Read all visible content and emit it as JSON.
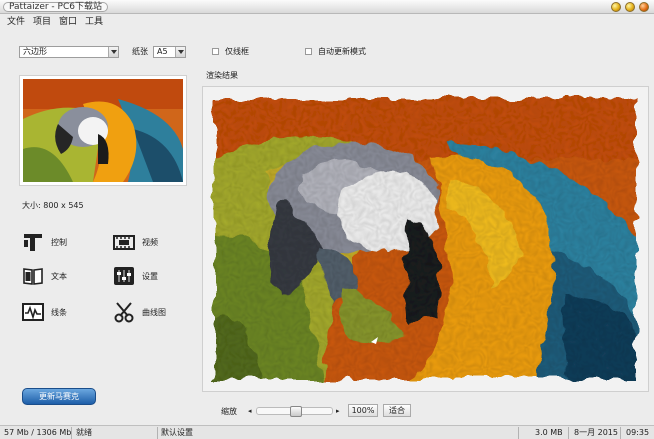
{
  "window": {
    "title": "Pattaizer - PC6下载站"
  },
  "menu": [
    "文件",
    "项目",
    "窗口",
    "工具"
  ],
  "controls": {
    "shape_select": "六边形",
    "paper_label": "纸张",
    "paper_select": "A5",
    "wireframe_label": "仅线框",
    "autoupdate_label": "自动更新模式"
  },
  "thumb": {
    "size_label": "大小: 800 x 545"
  },
  "tools": [
    {
      "label": "控制",
      "icon": "control-icon"
    },
    {
      "label": "视频",
      "icon": "film-icon"
    },
    {
      "label": "文本",
      "icon": "book-icon"
    },
    {
      "label": "设置",
      "icon": "sliders-icon"
    },
    {
      "label": "线条",
      "icon": "waveform-icon"
    },
    {
      "label": "曲线图",
      "icon": "scissors-icon"
    }
  ],
  "update_button": "更新马赛克",
  "render_label": "渲染结果",
  "zoom": {
    "label": "缩放",
    "value": "100%",
    "fit_label": "适合",
    "level": 0.5
  },
  "status": {
    "memory": "57 Mb / 1306 Mb",
    "state": "就绪",
    "settings": "默认设置",
    "filesize": "3.0 MB",
    "date": "8一月 2015",
    "time": "09:35"
  }
}
